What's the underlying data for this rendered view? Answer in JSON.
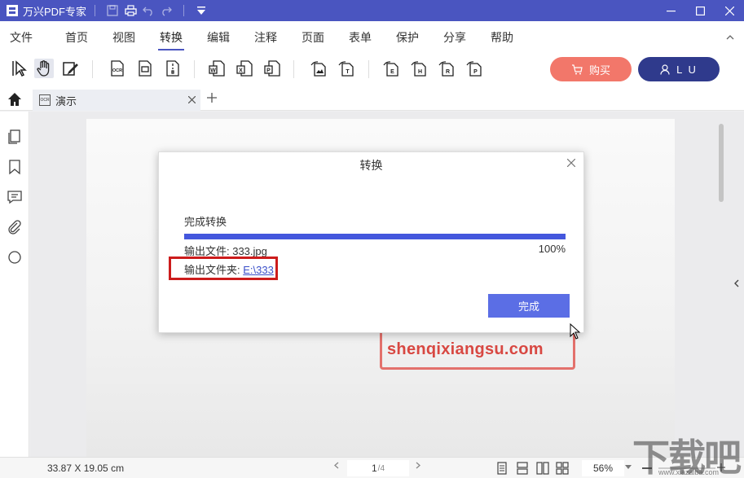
{
  "app": {
    "title": "万兴PDF专家"
  },
  "menu": {
    "items": [
      "文件",
      "首页",
      "视图",
      "转换",
      "编辑",
      "注释",
      "页面",
      "表单",
      "保护",
      "分享",
      "帮助"
    ],
    "active": "转换"
  },
  "toolbar": {
    "buy_label": "购买",
    "user_label": "L U",
    "ocr_label": "OCR"
  },
  "tab": {
    "label": "演示",
    "ocr_badge": "OCR"
  },
  "dialog": {
    "title": "转换",
    "status": "完成转换",
    "progress": 1.0,
    "file_line": "输出文件: 333.jpg",
    "percent": "100%",
    "folder_prefix": "输出文件夹: ",
    "folder_link": "E:\\333",
    "done_label": "完成"
  },
  "watermark": {
    "text": "shenqixiangsu.com"
  },
  "statusbar": {
    "dimensions": "33.87 X 19.05 cm",
    "page_current": "1",
    "page_total": "/4",
    "zoom": "56%"
  },
  "brand": {
    "mark": "下载吧",
    "url": "www.xiazaiba.com"
  },
  "colors": {
    "title_bar": "#4a55c0",
    "buy": "#f2776a",
    "user": "#2f3a8c",
    "progress": "#4457dd",
    "done_button": "#5b6ee5",
    "highlight": "#cc1c1c"
  }
}
